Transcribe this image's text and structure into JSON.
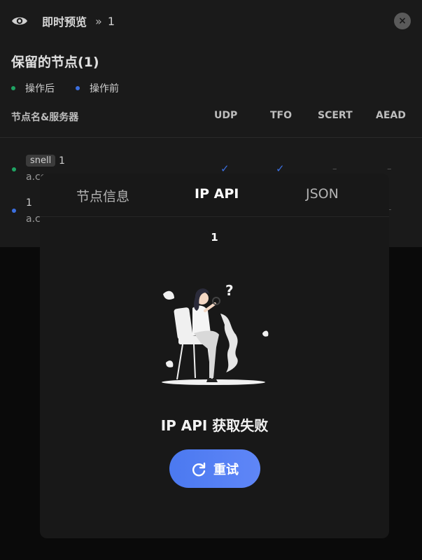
{
  "header": {
    "title": "即时预览",
    "separator": "»",
    "crumb": "1",
    "close_glyph": "×"
  },
  "section": {
    "title": "保留的节点(1)"
  },
  "legend": [
    {
      "label": "操作后",
      "color": "#1fa363"
    },
    {
      "label": "操作前",
      "color": "#3b6fe0"
    }
  ],
  "table": {
    "headers": [
      "节点名&服务器",
      "UDP",
      "TFO",
      "SCERT",
      "AEAD"
    ],
    "rows": [
      {
        "tag": "snell",
        "name": "1",
        "server": "a.co",
        "dot_color": "#1fa363",
        "udp": "✓",
        "tfo": "✓",
        "scert": "–",
        "aead": "–"
      },
      {
        "tag": "",
        "name": "1",
        "server": "a.co",
        "dot_color": "#3b6fe0",
        "udp": "",
        "tfo": "",
        "scert": "",
        "aead": "–"
      }
    ]
  },
  "modal": {
    "tabs": [
      {
        "label": "节点信息",
        "active": false
      },
      {
        "label": "IP API",
        "active": true
      },
      {
        "label": "JSON",
        "active": false
      }
    ],
    "subtitle": "1",
    "illustration": "woman-on-chair-confused-illustration",
    "error_message": "IP API 获取失败",
    "retry_label": "重试",
    "retry_icon": "refresh-icon"
  },
  "colors": {
    "accent": "#4b79f0",
    "success": "#1fa363",
    "before": "#3b6fe0"
  }
}
